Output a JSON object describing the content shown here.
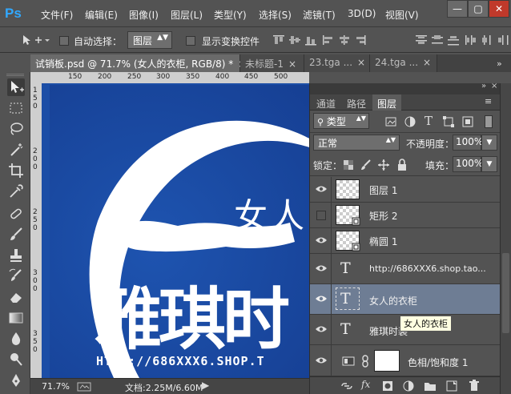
{
  "app": {
    "logo": "Ps"
  },
  "menu": [
    "文件(F)",
    "编辑(E)",
    "图像(I)",
    "图层(L)",
    "类型(Y)",
    "选择(S)",
    "滤镜(T)",
    "3D(D)",
    "视图(V)"
  ],
  "window_controls": {
    "minimize": "—",
    "restore": "▢",
    "close": "✕"
  },
  "options": {
    "auto_select_label": "自动选择：",
    "auto_select_target": "图层",
    "show_transform_label": "显示变换控件"
  },
  "tabs": [
    {
      "label": "试销板.psd @ 71.7% (女人的衣柜, RGB/8) *",
      "active": true
    },
    {
      "label": "未标题-1",
      "active": false
    },
    {
      "label": "23.tga ...",
      "active": false
    },
    {
      "label": "24.tga ...",
      "active": false
    }
  ],
  "ruler_top": [
    "150",
    "200",
    "250",
    "300",
    "350",
    "400",
    "450",
    "500"
  ],
  "ruler_left": [
    "1",
    "5",
    "0",
    "2",
    "0",
    "0",
    "2",
    "5",
    "0",
    "3",
    "0",
    "0",
    "3",
    "5",
    "0"
  ],
  "canvas": {
    "headline_small": "女人",
    "headline_big": "雅琪时",
    "url_text": "HTTP://686XXX6.SHOP.T"
  },
  "status": {
    "zoom": "71.7%",
    "doc_label": "文档:2.25M/6.60M"
  },
  "panel": {
    "tabs": [
      {
        "label": "通道",
        "active": false
      },
      {
        "label": "路径",
        "active": false
      },
      {
        "label": "图层",
        "active": true
      }
    ],
    "filter_label": "类型",
    "blend_mode": "正常",
    "opacity_label": "不透明度：",
    "opacity_value": "100%",
    "lock_label": "锁定：",
    "fill_label": "填充：",
    "fill_value": "100%",
    "layers": [
      {
        "name": "图层 1",
        "kind": "pixel",
        "visible": true,
        "selected": false
      },
      {
        "name": "矩形 2",
        "kind": "shape",
        "visible": false,
        "selected": false
      },
      {
        "name": "椭圆 1",
        "kind": "shape",
        "visible": true,
        "selected": false
      },
      {
        "name": "http://686XXX6.shop.tao...",
        "kind": "text",
        "visible": true,
        "selected": false
      },
      {
        "name": "女人的衣柜",
        "kind": "text",
        "visible": true,
        "selected": true
      },
      {
        "name": "雅琪时装",
        "kind": "text",
        "visible": true,
        "selected": false
      },
      {
        "name": "色相/饱和度 1",
        "kind": "adjustment",
        "visible": true,
        "selected": false
      }
    ],
    "tooltip": "女人的衣柜"
  },
  "colors": {
    "accent": "#31a8ff",
    "canvas_blue": "#1c4ea6",
    "selected_row": "#6e7d94"
  }
}
